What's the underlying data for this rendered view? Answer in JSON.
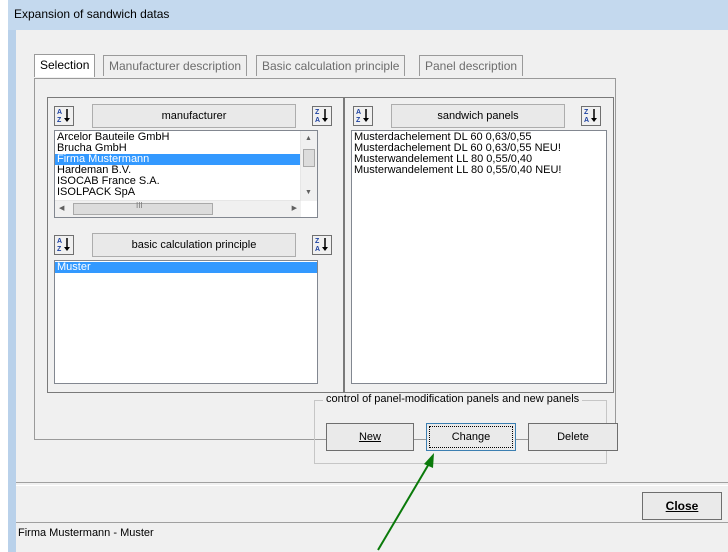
{
  "window": {
    "title": "Expansion of sandwich datas"
  },
  "tabs": [
    {
      "label": "Selection",
      "active": true
    },
    {
      "label": "Manufacturer description",
      "active": false
    },
    {
      "label": "Basic calculation principle",
      "active": false
    },
    {
      "label": "Panel description",
      "active": false
    }
  ],
  "manufacturer": {
    "header_label": "manufacturer",
    "items": [
      "Arcelor Bauteile GmbH",
      "Brucha GmbH",
      "Firma Mustermann",
      "Hardeman B.V.",
      "ISOCAB France S.A.",
      "ISOLPACK SpA"
    ],
    "selected_index": 2
  },
  "basic_calc": {
    "header_label": "basic calculation principle",
    "items": [
      "Muster"
    ],
    "selected_index": 0
  },
  "panels": {
    "header_label": "sandwich panels",
    "items": [
      "Musterdachelement DL 60 0,63/0,55",
      "Musterdachelement DL 60 0,63/0,55 NEU!",
      "Musterwandelement LL 80 0,55/0,40",
      "Musterwandelement LL 80 0,55/0,40 NEU!"
    ]
  },
  "control": {
    "legend": "control of panel-modification panels and new panels",
    "new_label": "New",
    "change_label": "Change",
    "delete_label": "Delete"
  },
  "close_label": "Close",
  "status": {
    "text": "Firma Mustermann - Muster"
  },
  "colors": {
    "selection": "#3399ff",
    "annotation_arrow": "#0a7a0a"
  }
}
